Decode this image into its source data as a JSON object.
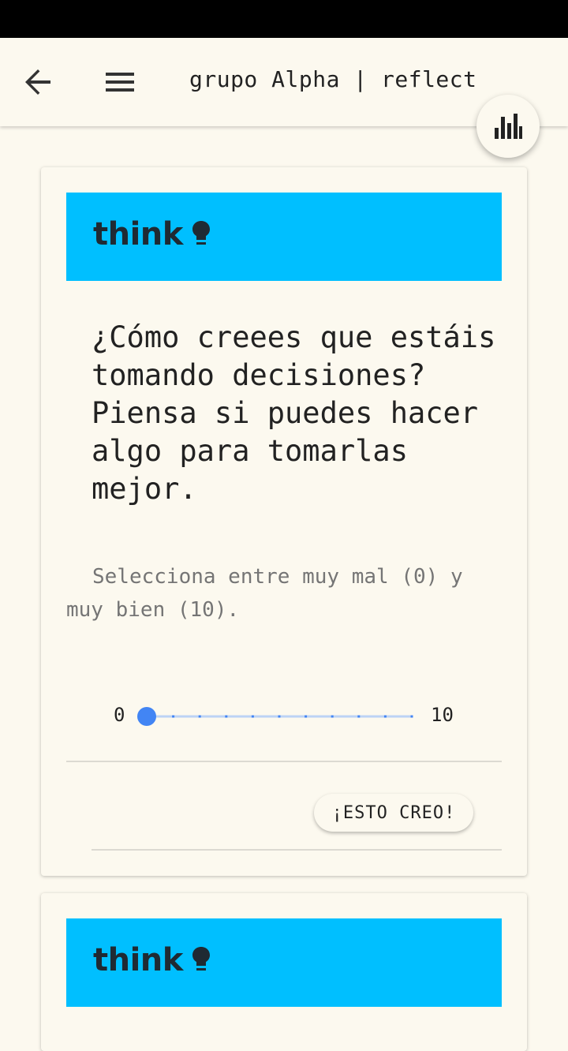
{
  "app_bar": {
    "title": "grupo Alpha | reflect",
    "back_icon": "arrow-left-icon",
    "menu_icon": "hamburger-menu-icon"
  },
  "fab": {
    "icon": "bar-chart-icon"
  },
  "cards": [
    {
      "banner_label": "think",
      "banner_icon": "lightbulb-icon",
      "question": "¿Cómo creees que estáis tomando decisiones? Piensa si puedes hacer algo para tomarlas mejor.",
      "hint": "Selecciona entre muy mal (0) y muy bien (10).",
      "slider": {
        "min_label": "0",
        "max_label": "10",
        "value": 0,
        "min": 0,
        "max": 10
      },
      "action_label": "¡ESTO CREO!"
    },
    {
      "banner_label": "think",
      "banner_icon": "lightbulb-icon"
    }
  ],
  "colors": {
    "background": "#fcf9ef",
    "banner": "#00bfff",
    "accent": "#4285f4",
    "track": "#bcd3f5"
  }
}
